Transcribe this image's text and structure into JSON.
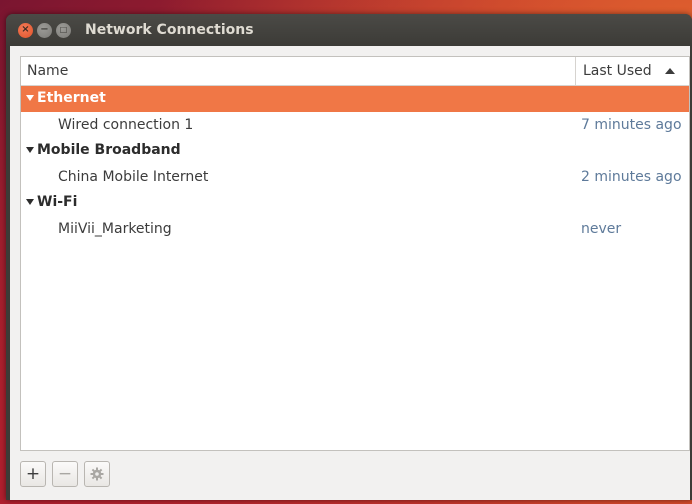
{
  "window": {
    "title": "Network Connections",
    "controls": {
      "close_glyph": "×",
      "minimize_glyph": "−",
      "maximize_glyph": "□"
    }
  },
  "list": {
    "columns": {
      "name": "Name",
      "last_used": "Last Used"
    },
    "sort_indicator": "sort-ascending-icon",
    "groups": [
      {
        "label": "Ethernet",
        "selected": true,
        "connections": [
          {
            "name": "Wired connection 1",
            "last_used": "7 minutes ago"
          }
        ]
      },
      {
        "label": "Mobile Broadband",
        "selected": false,
        "connections": [
          {
            "name": "China Mobile Internet",
            "last_used": "2 minutes ago"
          }
        ]
      },
      {
        "label": "Wi-Fi",
        "selected": false,
        "connections": [
          {
            "name": "MiiVii_Marketing",
            "last_used": "never"
          }
        ]
      }
    ]
  },
  "toolbar": {
    "add_label": "+",
    "remove_label": "−",
    "settings_icon": "gear-icon"
  },
  "colors": {
    "selection": "#f07746",
    "titlebar": "#3c3b37",
    "close_button": "#e2532a",
    "timestamp": "#5e7a9a"
  }
}
